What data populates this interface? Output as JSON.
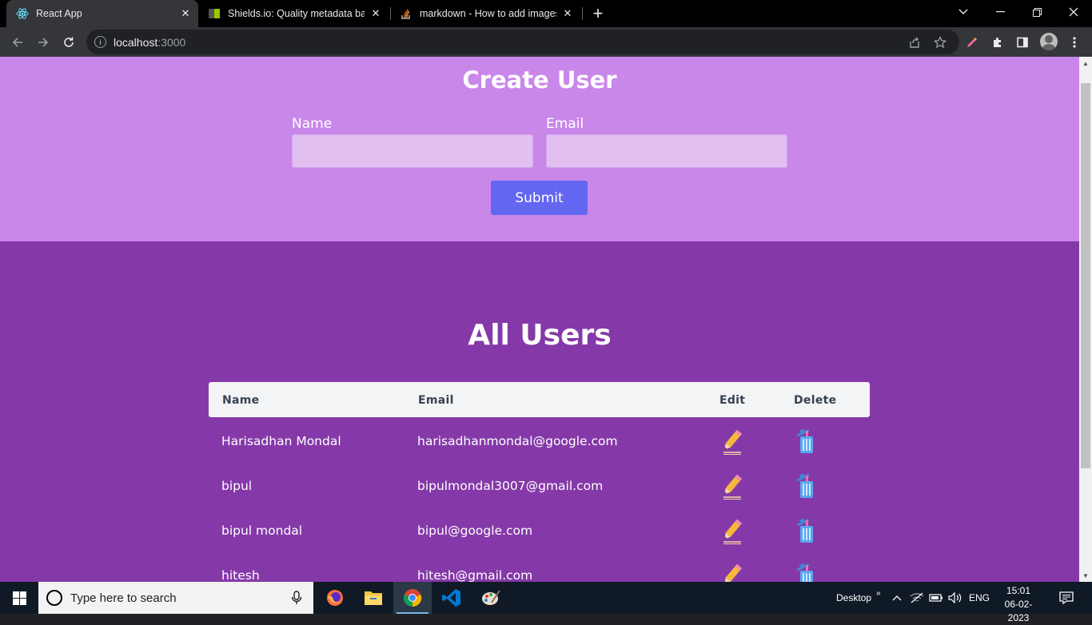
{
  "browser": {
    "tabs": [
      {
        "title": "React App",
        "favicon": "react-icon",
        "active": true
      },
      {
        "title": "Shields.io: Quality metadata badg",
        "favicon": "shields-icon",
        "active": false
      },
      {
        "title": "markdown - How to add images",
        "favicon": "stackoverflow-icon",
        "active": false
      }
    ],
    "url_host": "localhost",
    "url_port": ":3000"
  },
  "create_user": {
    "heading": "Create User",
    "name_label": "Name",
    "name_value": "",
    "email_label": "Email",
    "email_value": "",
    "submit_label": "Submit"
  },
  "all_users": {
    "heading": "All Users",
    "columns": [
      "Name",
      "Email",
      "Edit",
      "Delete"
    ],
    "rows": [
      {
        "name": "Harisadhan Mondal",
        "email": "harisadhanmondal@google.com"
      },
      {
        "name": "bipul",
        "email": "bipulmondal3007@gmail.com"
      },
      {
        "name": "bipul mondal",
        "email": "bipul@google.com"
      },
      {
        "name": "hitesh",
        "email": "hitesh@gmail.com"
      }
    ]
  },
  "taskbar": {
    "search_placeholder": "Type here to search",
    "desktop_label": "Desktop",
    "language": "ENG",
    "time": "15:01",
    "date": "06-02-2023",
    "apps": [
      "firefox-icon",
      "file-explorer-icon",
      "chrome-icon",
      "vscode-icon",
      "paint-icon"
    ]
  },
  "colors": {
    "create_bg": "#c987ea",
    "users_bg": "#8539a8",
    "submit_bg": "#6366f1",
    "input_bg": "#e1bff1",
    "table_header_bg": "#f3f4f6"
  }
}
